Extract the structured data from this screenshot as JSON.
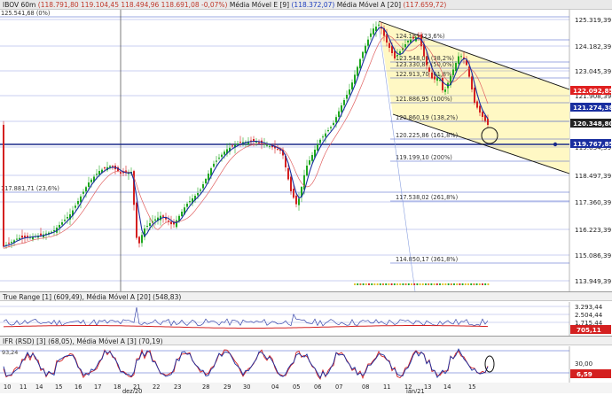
{
  "header": {
    "symbol": "IBOV 60m",
    "ohlc_text": "(118.791,80  119.104,45  118.494,96  118.691,08  -0,07%)",
    "ma_e9": "Média Móvel E [9]",
    "ma_e9_value": "(118.372,07)",
    "ma_a20": "Média Móvel A [20]",
    "ma_a20_value": "(117.659,72)"
  },
  "price_axis": {
    "ticks": [
      "125.319,39",
      "124.182,39",
      "123.045,39",
      "121.908,39",
      "120.771,39",
      "119.634,39",
      "118.497,39",
      "117.360,39",
      "116.223,39",
      "115.086,39",
      "113.949,39"
    ],
    "badges": [
      {
        "label": "122.092,85",
        "color": "#e02020"
      },
      {
        "label": "121.274,38",
        "color": "#1a2fa0"
      },
      {
        "label": "120.348,80",
        "color": "#222222"
      },
      {
        "label": "119.767,85",
        "color": "#1a2fa0"
      }
    ]
  },
  "fib_labels": [
    {
      "text": "125.541,68 (0%)"
    },
    {
      "text": "124.183 (23,6%)"
    },
    {
      "text": "123.548,03 (38,2%)"
    },
    {
      "text": "123.330,87 (50,0%)"
    },
    {
      "text": "122.913,70 (61,8%)"
    },
    {
      "text": "121.886,95 (100%)"
    },
    {
      "text": "120.860,19 (138,2%)"
    },
    {
      "text": "120.225,86 (161,8%)"
    },
    {
      "text": "119.199,10 (200%)"
    },
    {
      "text": "117.881,71 (23,6%)"
    },
    {
      "text": "117.538,02 (261,8%)"
    },
    {
      "text": "114.850,17 (361,8%)"
    }
  ],
  "true_range": {
    "title": "True Range [1]",
    "value": "(609,49)",
    "ma_title": "Média Móvel A [20]",
    "ma_value": "(548,83)",
    "ticks": [
      "3.293,44",
      "2.504,44",
      "1.715,44"
    ],
    "badge": "705,11"
  },
  "ifr": {
    "title": "IFR (RSD) [3]",
    "value": "(68,05)",
    "ma_title": "Média Móvel A [3]",
    "ma_value": "(70,19)",
    "ticks": [
      "30,00"
    ],
    "left_label": "93,24",
    "badge": "6,59"
  },
  "x_axis": {
    "days": [
      "10",
      "11",
      "14",
      "15",
      "16",
      "17",
      "18",
      "21",
      "22",
      "23",
      "28",
      "29",
      "30",
      "04",
      "05",
      "06",
      "07",
      "08",
      "11",
      "12",
      "13",
      "14",
      "15"
    ],
    "months": [
      "dez/20",
      "jan/21"
    ]
  },
  "colors": {
    "bull": "#1fa81f",
    "bear": "#d42020",
    "ma_blue": "#1a2fa0",
    "ma_red": "#e06060",
    "channel_fill": "#fff8c4",
    "grid": "#3a52c8"
  }
}
